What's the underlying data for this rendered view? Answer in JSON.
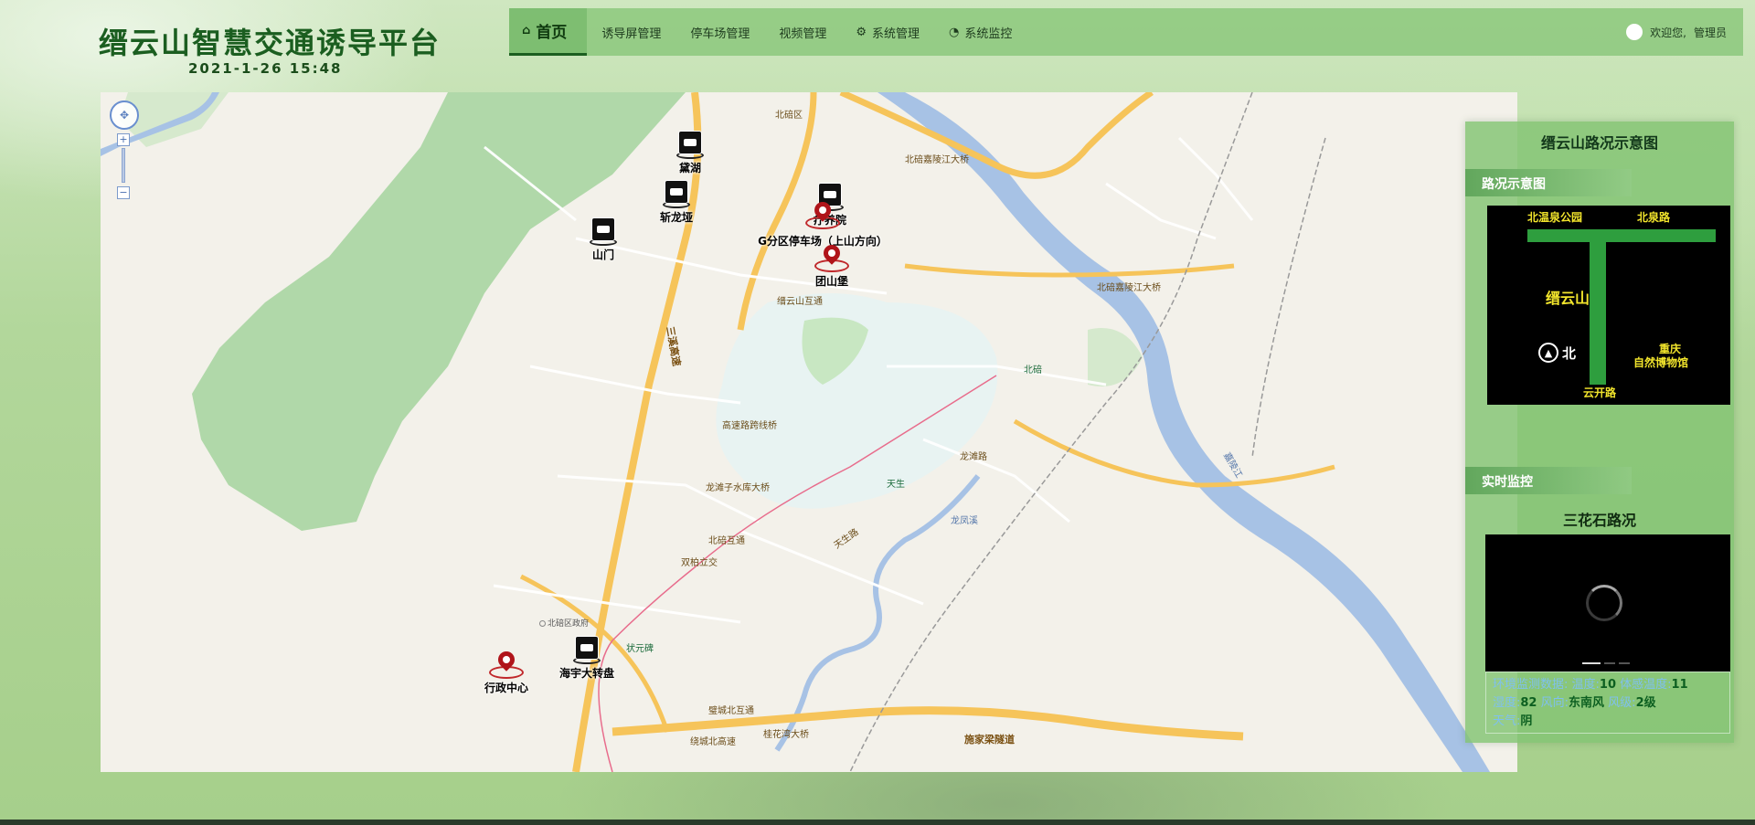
{
  "header": {
    "title": "缙云山智慧交通诱导平台",
    "datetime": "2021-1-26  15:48"
  },
  "nav": {
    "items": [
      {
        "label": "首页",
        "icon": "home-icon",
        "active": true
      },
      {
        "label": "诱导屏管理",
        "icon": "",
        "active": false
      },
      {
        "label": "停车场管理",
        "icon": "",
        "active": false
      },
      {
        "label": "视频管理",
        "icon": "",
        "active": false
      },
      {
        "label": "系统管理",
        "icon": "gear-icon",
        "active": false
      },
      {
        "label": "系统监控",
        "icon": "monitor-icon",
        "active": false
      }
    ],
    "user_greeting": "欢迎您,",
    "user_name": "管理员"
  },
  "map": {
    "markers": [
      {
        "type": "camera",
        "label": "黛湖"
      },
      {
        "type": "camera",
        "label": "斩龙垭"
      },
      {
        "type": "camera",
        "label": "山门"
      },
      {
        "type": "camera",
        "label": "疗养院"
      },
      {
        "type": "pin",
        "label": "G分区停车场（上山方向）"
      },
      {
        "type": "pin",
        "label": "团山堡"
      },
      {
        "type": "pin",
        "label": "行政中心"
      },
      {
        "type": "camera",
        "label": "海宇大转盘"
      }
    ],
    "places": [
      "北碚区",
      "嘉陵江",
      "北碚嘉陵江大桥",
      "北碚嘉陵江大桥",
      "北碚区政府",
      "三溪高速",
      "缙云山互通",
      "北碚互通",
      "高速路跨线桥",
      "龙滩子水库大桥",
      "双柏立交",
      "天生路",
      "龙凤溪",
      "北碚",
      "天生",
      "状元碑",
      "璧城北互通",
      "绕城北高速",
      "桂花湾大桥",
      "施家梁隧道",
      "龙滩路"
    ]
  },
  "panel": {
    "title": "缙云山路况示意图",
    "diagram_section": "路况示意图",
    "diagram_labels": {
      "top_left": "北温泉公园",
      "top_right": "北泉路",
      "left": "缙云山",
      "right_line1": "重庆",
      "right_line2": "自然博物馆",
      "bottom": "云开路",
      "north": "北"
    },
    "monitor_section": "实时监控",
    "video_title": "三花石路况",
    "env": {
      "label": "环境监测数据:",
      "temp_label": "温度:",
      "temp": "10",
      "feel_label": "体感温度:",
      "feel": "11",
      "humidity_label": "湿度:",
      "humidity": "82",
      "wind_dir_label": "风向:",
      "wind_dir": "东南风",
      "wind_level_label": "风级:",
      "wind_level": "2级",
      "weather_label": "天气:",
      "weather": "阴"
    }
  },
  "colors": {
    "brand": "#1b5e20",
    "nav_bg": "#8cc87d",
    "diagram_road": "#2e9e3e",
    "diagram_text": "#f2e52c"
  }
}
